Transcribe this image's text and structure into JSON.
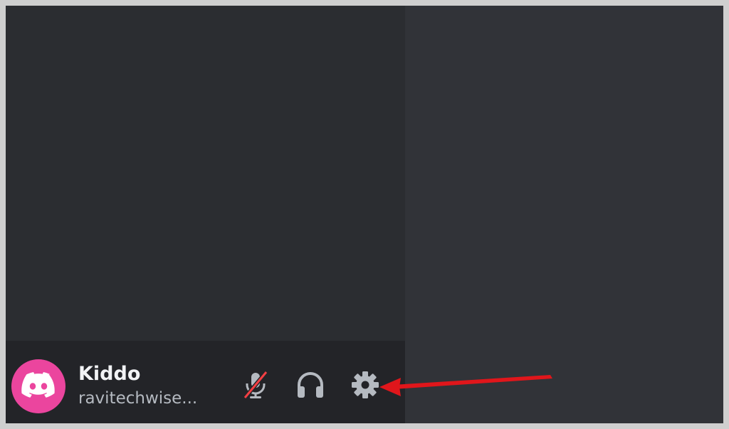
{
  "user_panel": {
    "display_name": "Kiddo",
    "username": "ravitechwise...",
    "avatar_color": "#eb459e",
    "avatar_icon": "discord-logo-icon"
  },
  "controls": [
    {
      "name": "mute-button",
      "icon": "microphone-muted-icon",
      "state": "muted"
    },
    {
      "name": "deafen-button",
      "icon": "headphones-icon"
    },
    {
      "name": "user-settings-button",
      "icon": "gear-icon"
    }
  ],
  "colors": {
    "sidebar": "#2b2d31",
    "main": "#313338",
    "user_panel": "#232428",
    "muted_slash": "#f23f43",
    "annotation_arrow": "#e0161b"
  }
}
